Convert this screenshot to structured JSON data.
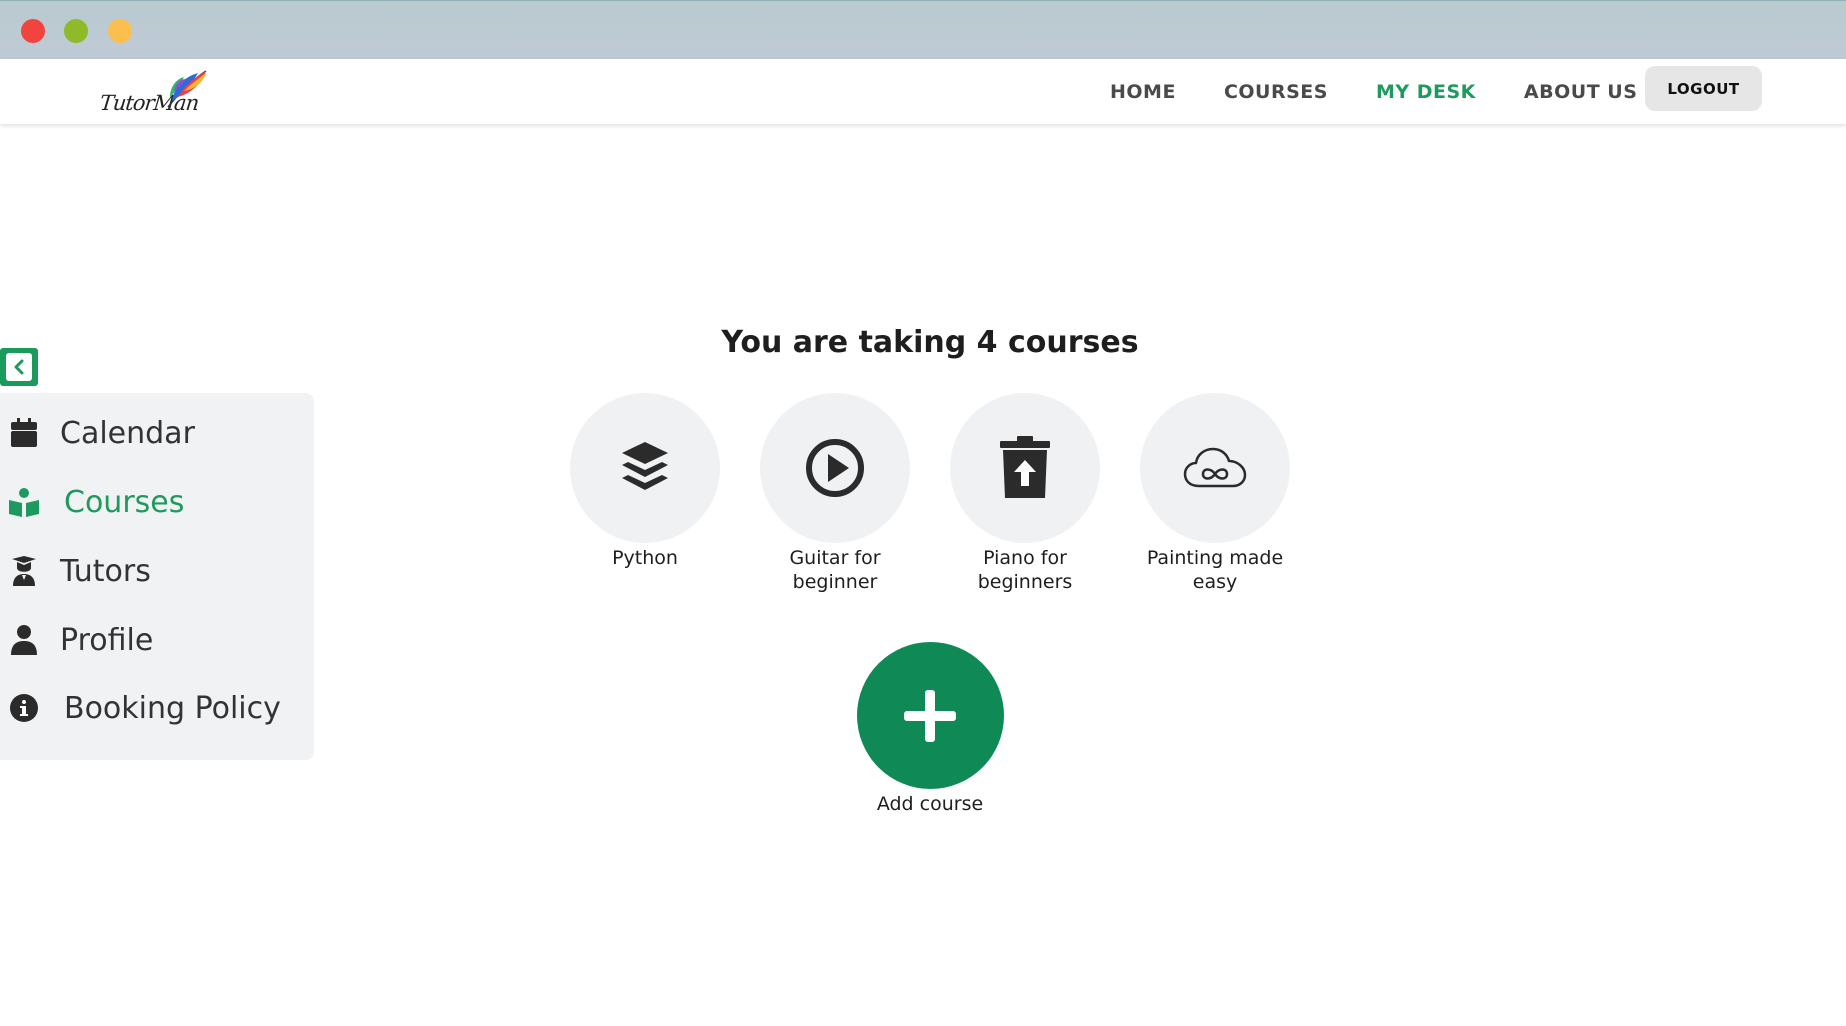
{
  "window": {
    "controls": [
      "close",
      "minimize",
      "zoom"
    ],
    "colors": {
      "close": "#f2443e",
      "minimize": "#8fba2a",
      "zoom": "#fbbf4d"
    }
  },
  "brand": {
    "logo_text": "TutorMan"
  },
  "nav": {
    "links": [
      {
        "label": "HOME",
        "active": false
      },
      {
        "label": "COURSES",
        "active": false
      },
      {
        "label": "MY DESK",
        "active": true
      },
      {
        "label": "ABOUT US",
        "active": false
      }
    ],
    "logout_label": "LOGOUT",
    "active_color": "#1e9a5e"
  },
  "sidebar": {
    "toggle_icon": "collapse-left-icon",
    "items": [
      {
        "label": "Calendar",
        "icon": "calendar-icon",
        "active": false
      },
      {
        "label": "Courses",
        "icon": "book-reader-icon",
        "active": true
      },
      {
        "label": "Tutors",
        "icon": "graduate-icon",
        "active": false
      },
      {
        "label": "Profile",
        "icon": "user-icon",
        "active": false
      },
      {
        "label": "Booking Policy",
        "icon": "info-icon",
        "active": false
      }
    ]
  },
  "main": {
    "heading": "You are taking 4 courses",
    "courses": [
      {
        "name": "Python",
        "icon": "layers-icon"
      },
      {
        "name": "Guitar for beginner",
        "icon": "play-circle-icon"
      },
      {
        "name": "Piano for beginners",
        "icon": "trash-upload-icon"
      },
      {
        "name": "Painting made easy",
        "icon": "cloud-infinity-icon"
      }
    ],
    "add_course_label": "Add course",
    "add_color": "#0f8a57"
  }
}
